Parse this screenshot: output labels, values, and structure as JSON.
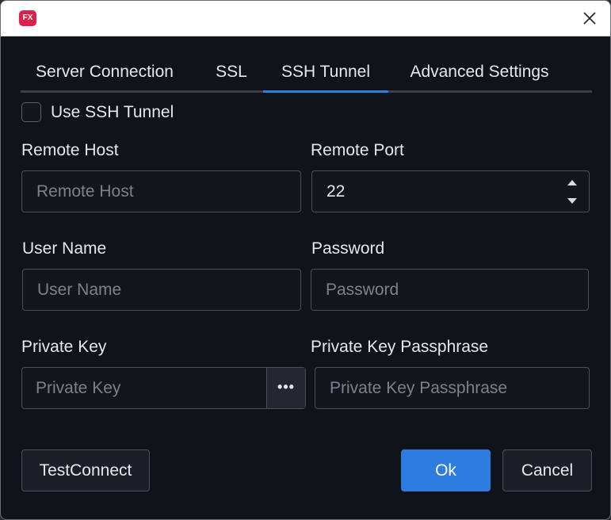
{
  "window": {
    "app_icon_text": "FX",
    "close_icon": "close-icon"
  },
  "tabs": [
    {
      "label": "Server Connection",
      "active": false
    },
    {
      "label": "SSL",
      "active": false
    },
    {
      "label": "SSH Tunnel",
      "active": true
    },
    {
      "label": "Advanced Settings",
      "active": false
    }
  ],
  "ssh": {
    "use_tunnel_label": "Use SSH Tunnel",
    "use_tunnel_checked": false,
    "remote_host_label": "Remote Host",
    "remote_host_placeholder": "Remote Host",
    "remote_host_value": "",
    "remote_port_label": "Remote Port",
    "remote_port_value": "22",
    "user_name_label": "User Name",
    "user_name_placeholder": "User Name",
    "password_label": "Password",
    "password_placeholder": "Password",
    "private_key_label": "Private Key",
    "private_key_placeholder": "Private Key",
    "browse_label": "•••",
    "passphrase_label": "Private Key Passphrase",
    "passphrase_placeholder": "Private Key Passphrase"
  },
  "footer": {
    "test_label": "TestConnect",
    "ok_label": "Ok",
    "cancel_label": "Cancel"
  },
  "colors": {
    "background": "#0f131a",
    "accent": "#2f7ce0",
    "app_icon": "#e0204a"
  }
}
